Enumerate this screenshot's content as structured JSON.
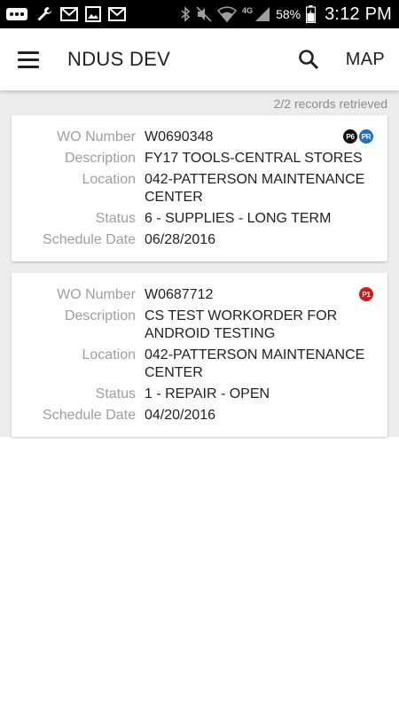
{
  "status_bar": {
    "battery_percent": "58%",
    "time": "3:12 PM",
    "network": "4G",
    "icons": [
      "more-icon",
      "wrench-icon",
      "gmail-icon",
      "image-icon",
      "gmail-icon",
      "bluetooth-icon",
      "mute-icon",
      "wifi-icon",
      "signal-icon",
      "battery-icon"
    ]
  },
  "app_bar": {
    "title": "NDUS DEV",
    "map_label": "MAP",
    "menu_icon": "hamburger-menu-icon",
    "search_icon": "search-icon"
  },
  "records": {
    "count_text": "2/2 records retrieved"
  },
  "labels": {
    "wo_number": "WO Number",
    "description": "Description",
    "location": "Location",
    "status": "Status",
    "schedule_date": "Schedule Date"
  },
  "work_orders": [
    {
      "wo_number": "W0690348",
      "description": "FY17 TOOLS-CENTRAL STORES",
      "location": "042-PATTERSON MAINTENANCE CENTER",
      "status": "6 - SUPPLIES - LONG TERM",
      "schedule_date": "06/28/2016",
      "badges": [
        {
          "text": "P6",
          "color": "#111111"
        },
        {
          "text": "PR",
          "color": "#1e6fc5"
        }
      ]
    },
    {
      "wo_number": "W0687712",
      "description": "CS TEST WORKORDER FOR ANDROID TESTING",
      "location": "042-PATTERSON MAINTENANCE CENTER",
      "status": "1 - REPAIR - OPEN",
      "schedule_date": "04/20/2016",
      "badges": [
        {
          "text": "P1",
          "color": "#d01a1a"
        }
      ]
    }
  ]
}
